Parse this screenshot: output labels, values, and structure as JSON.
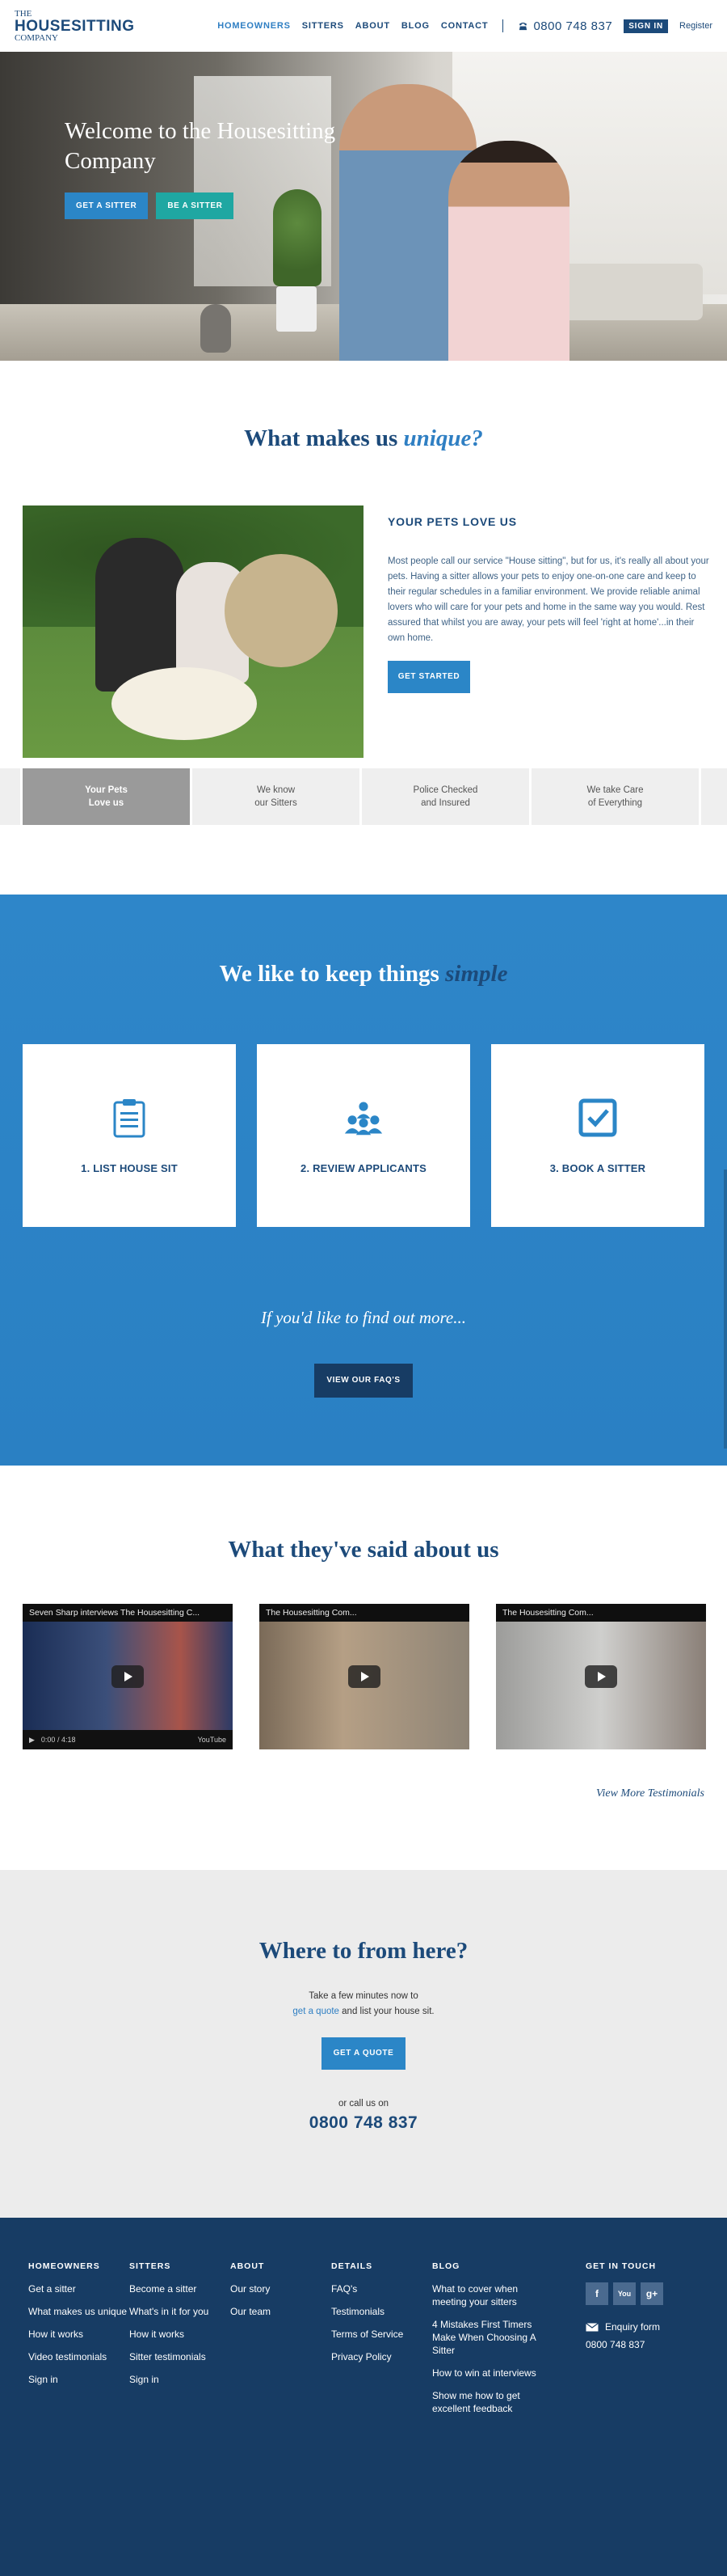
{
  "header": {
    "logo": {
      "line1": "THE",
      "line2": "HOUSESITTING",
      "line3": "COMPANY"
    },
    "nav": [
      "HOMEOWNERS",
      "SITTERS",
      "ABOUT",
      "BLOG",
      "CONTACT"
    ],
    "phone": "0800 748 837",
    "signin": "SIGN IN",
    "register": "Register",
    "colors": {
      "primary": "#1c4a7a",
      "active": "#2f7fc3"
    }
  },
  "hero": {
    "title": "Welcome to the Housesitting Company",
    "btn_sitter": "GET A SITTER",
    "btn_be_sitter": "BE A SITTER"
  },
  "unique": {
    "title_plain": "What makes us",
    "title_em": "unique?",
    "heading": "YOUR PETS LOVE US",
    "body": "Most people call our service \"House sitting\", but for us, it's really all about your pets. Having a sitter allows your pets to enjoy one-on-one care and keep to their regular schedules in a familiar environment. We provide reliable animal lovers who will care for your pets and home in the same way you would. Rest assured that whilst you are away, your pets will feel 'right at home'...in their own home.",
    "cta": "GET STARTED",
    "tabs": [
      {
        "line1": "Your Pets",
        "line2": "Love us"
      },
      {
        "line1": "We know",
        "line2": "our Sitters"
      },
      {
        "line1": "Police Checked",
        "line2": "and Insured"
      },
      {
        "line1": "We take Care",
        "line2": "of Everything"
      }
    ]
  },
  "simple": {
    "title_plain": "We like to keep things",
    "title_em": "simple",
    "steps": [
      {
        "label": "1. LIST HOUSE SIT",
        "icon": "clipboard-icon"
      },
      {
        "label": "2. REVIEW APPLICANTS",
        "icon": "people-icon"
      },
      {
        "label": "3. BOOK A SITTER",
        "icon": "checkbox-icon"
      }
    ],
    "find_more": "If you'd like to find out more...",
    "cta": "VIEW OUR FAQ'S"
  },
  "testimonials": {
    "title": "What they've said about us",
    "videos": [
      {
        "title": "Seven Sharp interviews The Housesitting C...",
        "time": "0:00 / 4:18",
        "brand": "YouTube"
      },
      {
        "title": "The Housesitting Com..."
      },
      {
        "title": "The Housesitting Com..."
      }
    ],
    "more": "View More Testimonials"
  },
  "where": {
    "title": "Where to from here?",
    "line1": "Take a few minutes now to",
    "link": "get a quote",
    "line2_rest": " and list your house sit.",
    "cta": "GET A QUOTE",
    "or_call": "or call us on",
    "phone": "0800 748 837"
  },
  "footer": {
    "cols": [
      {
        "heading": "HOMEOWNERS",
        "items": [
          "Get a sitter",
          "What makes us unique",
          "How it works",
          "Video testimonials",
          "Sign in"
        ]
      },
      {
        "heading": "SITTERS",
        "items": [
          "Become a sitter",
          "What's in it for you",
          "How it works",
          "Sitter testimonials",
          "Sign in"
        ]
      },
      {
        "heading": "ABOUT",
        "items": [
          "Our story",
          "Our team"
        ]
      },
      {
        "heading": "DETAILS",
        "items": [
          "FAQ's",
          "Testimonials",
          "Terms of Service",
          "Privacy Policy"
        ]
      },
      {
        "heading": "BLOG",
        "items": [
          "What to cover when meeting your sitters",
          "4 Mistakes First Timers Make When Choosing A Sitter",
          "How to win at interviews",
          "Show me how to get excellent feedback"
        ]
      }
    ],
    "contact": {
      "heading": "GET IN TOUCH",
      "socials": [
        "f",
        "You",
        "g+"
      ],
      "enquiry": "Enquiry form",
      "phone": "0800 748 837"
    }
  }
}
